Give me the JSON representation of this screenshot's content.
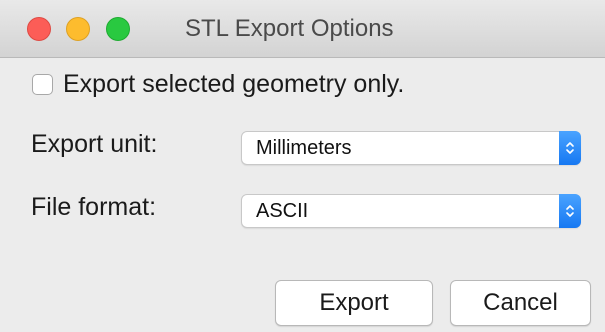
{
  "window": {
    "title": "STL Export Options"
  },
  "options": {
    "selected_only": {
      "label": "Export selected geometry only.",
      "checked": false
    },
    "export_unit": {
      "label": "Export unit:",
      "value": "Millimeters"
    },
    "file_format": {
      "label": "File format:",
      "value": "ASCII"
    }
  },
  "buttons": {
    "export": "Export",
    "cancel": "Cancel"
  },
  "icons": {
    "close": "close-traffic-light-icon",
    "minimize": "minimize-traffic-light-icon",
    "zoom": "zoom-traffic-light-icon",
    "select_arrows": "updown-chevron-icon"
  },
  "colors": {
    "close": "#fc5d57",
    "minimize": "#fdbc2e",
    "zoom": "#29c940",
    "accent": "#1678f2"
  }
}
